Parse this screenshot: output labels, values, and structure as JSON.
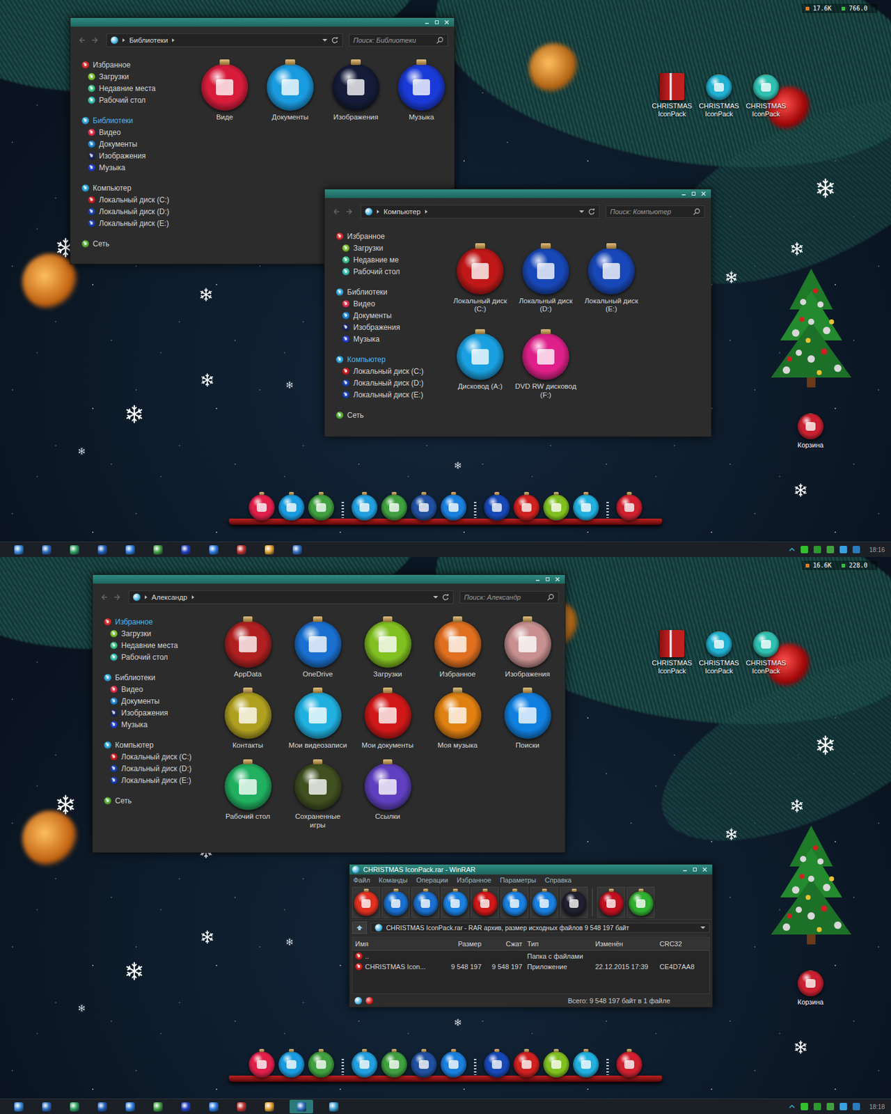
{
  "screens": [
    {
      "monitor": {
        "net": "17.6K",
        "value": "766.0"
      },
      "explorers": [
        {
          "address": "Библиотеки",
          "search_placeholder": "Поиск: Библиотеки",
          "nav": [
            {
              "label": "Избранное",
              "selected": false,
              "color": "#d83030",
              "children": [
                {
                  "label": "Загрузки",
                  "selected": false,
                  "color": "#7cc232"
                },
                {
                  "label": "Недавние места",
                  "selected": false,
                  "color": "#3cc08c"
                },
                {
                  "label": "Рабочий стол",
                  "selected": false,
                  "color": "#3cc0b4"
                }
              ]
            },
            {
              "label": "Библиотеки",
              "selected": true,
              "color": "#3aa8e0",
              "children": [
                {
                  "label": "Видео",
                  "selected": false,
                  "color": "#e0304c"
                },
                {
                  "label": "Документы",
                  "selected": false,
                  "color": "#1f86d6"
                },
                {
                  "label": "Изображения",
                  "selected": false,
                  "color": "#1c2a66"
                },
                {
                  "label": "Музыка",
                  "selected": false,
                  "color": "#2240d0"
                }
              ]
            },
            {
              "label": "Компьютер",
              "selected": false,
              "color": "#30a4d8",
              "children": [
                {
                  "label": "Локальный диск (C:)",
                  "selected": false,
                  "color": "#c82020"
                },
                {
                  "label": "Локальный диск (D:)",
                  "selected": false,
                  "color": "#1a44b0"
                },
                {
                  "label": "Локальный диск (E:)",
                  "selected": false,
                  "color": "#1a44b0"
                }
              ]
            },
            {
              "label": "Сеть",
              "selected": false,
              "color": "#5cb040",
              "children": []
            }
          ],
          "items": [
            {
              "label": "Виде",
              "color": "#d81c3c"
            },
            {
              "label": "Документы",
              "color": "#1a9be0"
            },
            {
              "label": "Изображения",
              "color": "#141c38"
            },
            {
              "label": "Музыка",
              "color": "#1a3ad8"
            }
          ]
        },
        {
          "address": "Компьютер",
          "search_placeholder": "Поиск: Компьютер",
          "nav": [
            {
              "label": "Избранное",
              "selected": false,
              "color": "#d83030",
              "children": [
                {
                  "label": "Загрузки",
                  "selected": false,
                  "color": "#7cc232"
                },
                {
                  "label": "Недавние ме",
                  "selected": false,
                  "color": "#3cc08c"
                },
                {
                  "label": "Рабочий стол",
                  "selected": false,
                  "color": "#3cc0b4"
                }
              ]
            },
            {
              "label": "Библиотеки",
              "selected": false,
              "color": "#3aa8e0",
              "children": [
                {
                  "label": "Видео",
                  "selected": false,
                  "color": "#e0304c"
                },
                {
                  "label": "Документы",
                  "selected": false,
                  "color": "#1f86d6"
                },
                {
                  "label": "Изображения",
                  "selected": false,
                  "color": "#1c2a66"
                },
                {
                  "label": "Музыка",
                  "selected": false,
                  "color": "#2240d0"
                }
              ]
            },
            {
              "label": "Компьютер",
              "selected": true,
              "color": "#30a4d8",
              "children": [
                {
                  "label": "Локальный диск (C:)",
                  "selected": false,
                  "color": "#c82020"
                },
                {
                  "label": "Локальный диск (D:)",
                  "selected": false,
                  "color": "#1a44b0"
                },
                {
                  "label": "Локальный диск (E:)",
                  "selected": false,
                  "color": "#1a44b0"
                }
              ]
            },
            {
              "label": "Сеть",
              "selected": false,
              "color": "#5cb040",
              "children": []
            }
          ],
          "items": [
            {
              "label": "Локальный диск (C:)",
              "color": "#c01818"
            },
            {
              "label": "Локальный диск (D:)",
              "color": "#1848b8"
            },
            {
              "label": "Локальный диск (E:)",
              "color": "#1848b8"
            },
            {
              "label": "Дисковод (A:)",
              "color": "#1aa0e0"
            },
            {
              "label": "DVD RW дисковод (F:)",
              "color": "#e0208a"
            }
          ]
        }
      ],
      "desktop_icons": [
        {
          "label": "CHRISTMAS IconPack",
          "color": "#c02020"
        },
        {
          "label": "CHRISTMAS IconPack",
          "color": "#20b0d0"
        },
        {
          "label": "CHRISTMAS IconPack",
          "color": "#30c0b0"
        }
      ],
      "recycle_bin": {
        "label": "Корзина",
        "color": "#c82030"
      },
      "dock": [
        [
          {
            "color": "#e0204a"
          },
          {
            "color": "#1a9be0"
          },
          {
            "color": "#40a040"
          }
        ],
        [
          {
            "color": "#20a0e0"
          },
          {
            "color": "#40a040"
          },
          {
            "color": "#2050a0"
          },
          {
            "color": "#1a80e0"
          }
        ],
        [
          {
            "color": "#1848b8"
          },
          {
            "color": "#d02020"
          },
          {
            "color": "#80c020"
          },
          {
            "color": "#20b0e0"
          }
        ],
        [
          {
            "color": "#d02030"
          }
        ]
      ],
      "taskbar": {
        "items": [
          {
            "selected": false,
            "color": "#3a8ae0"
          },
          {
            "selected": false,
            "color": "#2a6ac0"
          },
          {
            "selected": false,
            "color": "#30a060"
          },
          {
            "selected": false,
            "color": "#2060c0"
          },
          {
            "selected": false,
            "color": "#3080e0"
          },
          {
            "selected": false,
            "color": "#40a040"
          },
          {
            "selected": false,
            "color": "#2040c0"
          },
          {
            "selected": false,
            "color": "#2a7ae0"
          },
          {
            "selected": false,
            "color": "#c03030"
          },
          {
            "selected": false,
            "color": "#e0a030"
          },
          {
            "selected": false,
            "color": "#3070c0"
          }
        ],
        "clock": "18:16"
      }
    },
    {
      "monitor": {
        "net": "16.6K",
        "value": "228.0"
      },
      "explorers": [
        {
          "address": "Александр",
          "search_placeholder": "Поиск: Александр",
          "nav": [
            {
              "label": "Избранное",
              "selected": true,
              "color": "#d83030",
              "children": [
                {
                  "label": "Загрузки",
                  "selected": false,
                  "color": "#7cc232"
                },
                {
                  "label": "Недавние места",
                  "selected": false,
                  "color": "#3cc08c"
                },
                {
                  "label": "Рабочий стол",
                  "selected": false,
                  "color": "#3cc0b4"
                }
              ]
            },
            {
              "label": "Библиотеки",
              "selected": false,
              "color": "#3aa8e0",
              "children": [
                {
                  "label": "Видео",
                  "selected": false,
                  "color": "#e0304c"
                },
                {
                  "label": "Документы",
                  "selected": false,
                  "color": "#1f86d6"
                },
                {
                  "label": "Изображения",
                  "selected": false,
                  "color": "#1c2a66"
                },
                {
                  "label": "Музыка",
                  "selected": false,
                  "color": "#2240d0"
                }
              ]
            },
            {
              "label": "Компьютер",
              "selected": false,
              "color": "#30a4d8",
              "children": [
                {
                  "label": "Локальный диск (C:)",
                  "selected": false,
                  "color": "#c82020"
                },
                {
                  "label": "Локальный диск (D:)",
                  "selected": false,
                  "color": "#1a44b0"
                },
                {
                  "label": "Локальный диск (E:)",
                  "selected": false,
                  "color": "#1a44b0"
                }
              ]
            },
            {
              "label": "Сеть",
              "selected": false,
              "color": "#5cb040",
              "children": []
            }
          ],
          "items": [
            {
              "label": "AppData",
              "color": "#b02020"
            },
            {
              "label": "OneDrive",
              "color": "#1a70d0"
            },
            {
              "label": "Загрузки",
              "color": "#80c020"
            },
            {
              "label": "Избранное",
              "color": "#e07020"
            },
            {
              "label": "Изображения",
              "color": "#c89090"
            },
            {
              "label": "Контакты",
              "color": "#b0a020"
            },
            {
              "label": "Мои видеозаписи",
              "color": "#20b0e0"
            },
            {
              "label": "Мои документы",
              "color": "#d01818"
            },
            {
              "label": "Моя музыка",
              "color": "#e08010"
            },
            {
              "label": "Поиски",
              "color": "#1080e0"
            },
            {
              "label": "Рабочий стол",
              "color": "#20b060"
            },
            {
              "label": "Сохраненные игры",
              "color": "#405020"
            },
            {
              "label": "Ссылки",
              "color": "#6040c0"
            }
          ]
        }
      ],
      "winrar": {
        "title": "CHRISTMAS IconPack.rar - WinRAR",
        "menu": [
          "Файл",
          "Команды",
          "Операции",
          "Избранное",
          "Параметры",
          "Справка"
        ],
        "toolbar": [
          [
            {
              "color": "#e03020"
            },
            {
              "color": "#1a70d0"
            },
            {
              "color": "#1a70d0"
            },
            {
              "color": "#1a80e0"
            },
            {
              "color": "#d01818"
            },
            {
              "color": "#1a80e0"
            },
            {
              "color": "#1a80e0"
            },
            {
              "color": "#202030"
            }
          ],
          [
            {
              "color": "#c01020"
            },
            {
              "color": "#30b030"
            }
          ]
        ],
        "path": "CHRISTMAS IconPack.rar - RAR архив, размер исходных файлов 9 548 197 байт",
        "columns": [
          "Имя",
          "Размер",
          "Сжат",
          "Тип",
          "Изменён",
          "CRC32"
        ],
        "rows": [
          {
            "selected": false,
            "color": "#d02020",
            "cells": [
              "..",
              "",
              "",
              "Папка с файлами",
              "",
              ""
            ]
          },
          {
            "selected": false,
            "color": "#d02020",
            "cells": [
              "CHRISTMAS Icon...",
              "9 548 197",
              "9 548 197",
              "Приложение",
              "22.12.2015 17:39",
              "CE4D7AA8"
            ]
          }
        ],
        "status": "Всего: 9 548 197 байт в 1 файле"
      },
      "desktop_icons": [
        {
          "label": "CHRISTMAS IconPack",
          "color": "#c02020"
        },
        {
          "label": "CHRISTMAS IconPack",
          "color": "#20b0d0"
        },
        {
          "label": "CHRISTMAS IconPack",
          "color": "#30c0b0"
        }
      ],
      "recycle_bin": {
        "label": "Корзина",
        "color": "#c82030"
      },
      "dock": [
        [
          {
            "color": "#e0204a"
          },
          {
            "color": "#1a9be0"
          },
          {
            "color": "#40a040"
          }
        ],
        [
          {
            "color": "#20a0e0"
          },
          {
            "color": "#40a040"
          },
          {
            "color": "#2050a0"
          },
          {
            "color": "#1a80e0"
          }
        ],
        [
          {
            "color": "#1848b8"
          },
          {
            "color": "#d02020"
          },
          {
            "color": "#80c020"
          },
          {
            "color": "#20b0e0"
          }
        ],
        [
          {
            "color": "#d02030"
          }
        ]
      ],
      "taskbar": {
        "items": [
          {
            "selected": false,
            "color": "#3a8ae0"
          },
          {
            "selected": false,
            "color": "#2a6ac0"
          },
          {
            "selected": false,
            "color": "#30a060"
          },
          {
            "selected": false,
            "color": "#2060c0"
          },
          {
            "selected": false,
            "color": "#3080e0"
          },
          {
            "selected": false,
            "color": "#40a040"
          },
          {
            "selected": false,
            "color": "#2040c0"
          },
          {
            "selected": false,
            "color": "#2a7ae0"
          },
          {
            "selected": false,
            "color": "#c03030"
          },
          {
            "selected": false,
            "color": "#e0a030"
          },
          {
            "selected": true,
            "color": "#3070c0"
          },
          {
            "selected": false,
            "color": "#3aa0d0"
          }
        ],
        "clock": "18:18"
      }
    }
  ]
}
